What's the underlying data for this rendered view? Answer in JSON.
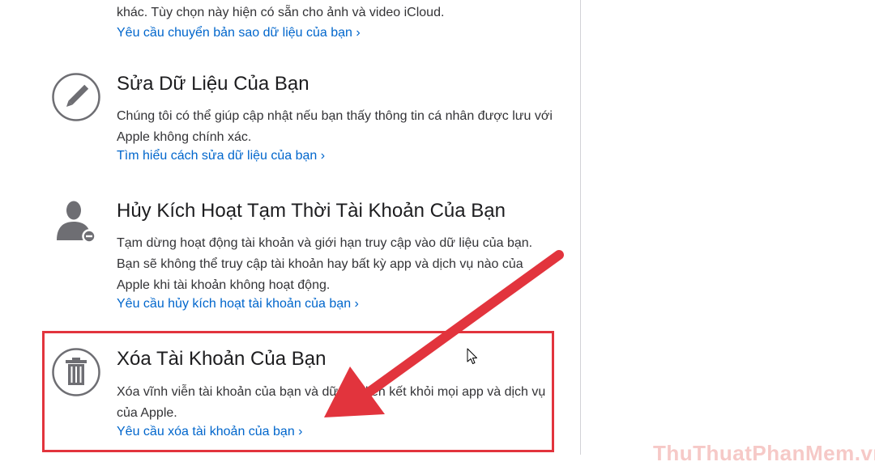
{
  "sections": [
    {
      "description": "khác. Tùy chọn này hiện có sẵn cho ảnh và video iCloud.",
      "link": "Yêu cầu chuyển bản sao dữ liệu của bạn ›"
    },
    {
      "icon": "pencil-icon",
      "title": "Sửa Dữ Liệu Của Bạn",
      "description": "Chúng tôi có thể giúp cập nhật nếu bạn thấy thông tin cá nhân được lưu với Apple không chính xác.",
      "link": "Tìm hiểu cách sửa dữ liệu của bạn ›"
    },
    {
      "icon": "person-minus-icon",
      "title": "Hủy Kích Hoạt Tạm Thời Tài Khoản Của Bạn",
      "description": "Tạm dừng hoạt động tài khoản và giới hạn truy cập vào dữ liệu của bạn. Bạn sẽ không thể truy cập tài khoản hay bất kỳ app và dịch vụ nào của Apple khi tài khoản không hoạt động.",
      "link": "Yêu cầu hủy kích hoạt tài khoản của bạn ›"
    },
    {
      "icon": "trash-icon",
      "title": "Xóa Tài Khoản Của Bạn",
      "description": "Xóa vĩnh viễn tài khoản của bạn và dữ liệu liên kết khỏi mọi app và dịch vụ của Apple.",
      "link": "Yêu cầu xóa tài khoản của bạn ›"
    }
  ],
  "watermark": "ThuThuatPhanMem.vn",
  "colors": {
    "link": "#0066cc",
    "annotation": "#e2343d",
    "icon": "#6e6e73"
  }
}
